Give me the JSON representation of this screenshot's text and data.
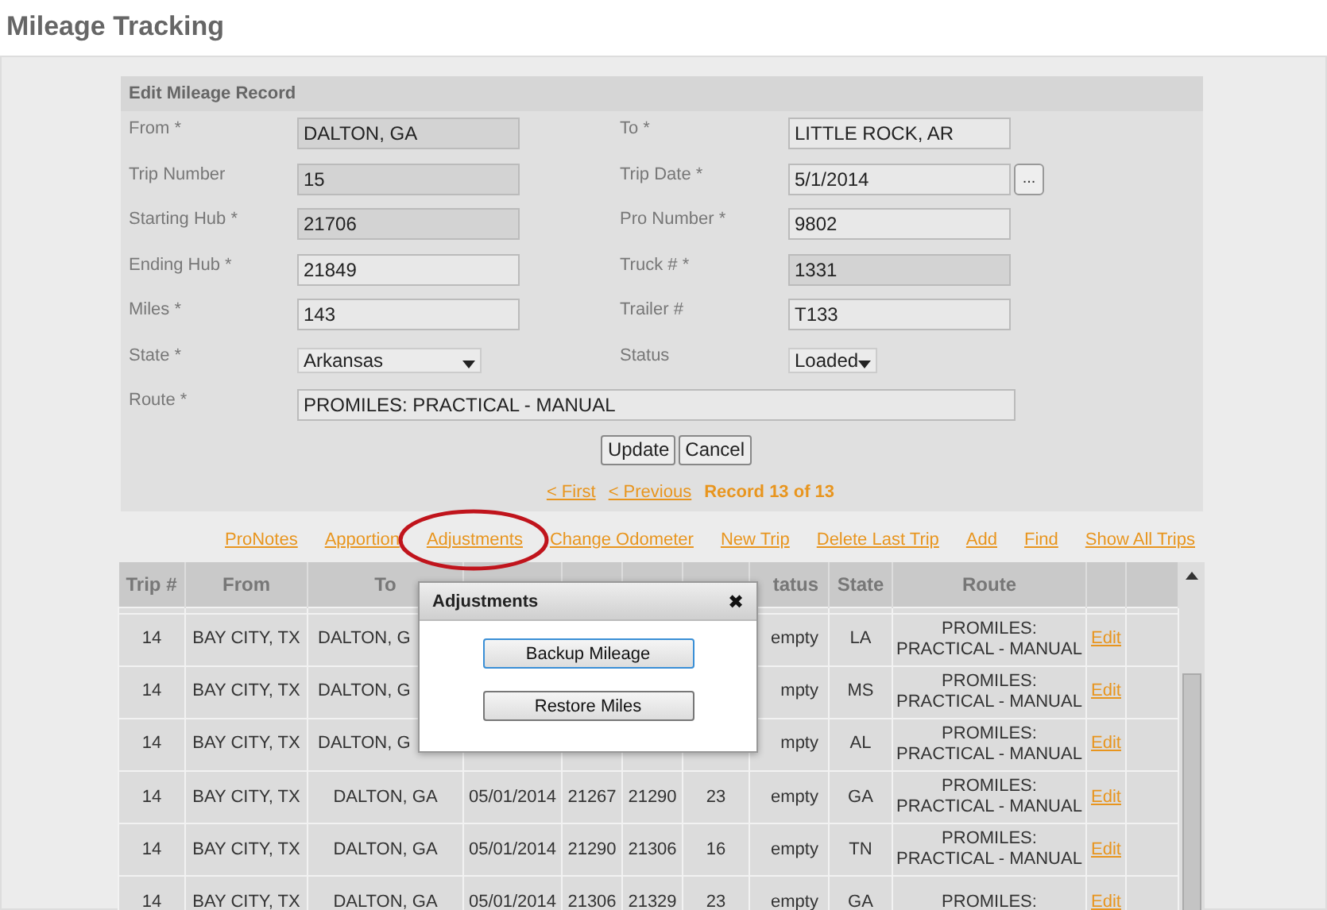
{
  "page_title": "Mileage Tracking",
  "form": {
    "title": "Edit Mileage Record",
    "fields": [
      {
        "label": "From *",
        "kind": "text",
        "value": "DALTON, GA",
        "readonly": true
      },
      {
        "label": "To *",
        "kind": "text",
        "value": "LITTLE ROCK, AR",
        "readonly": false
      },
      {
        "label": "Trip Number",
        "kind": "text",
        "value": "15",
        "readonly": true
      },
      {
        "label": "Trip Date *",
        "kind": "date",
        "value": "5/1/2014",
        "readonly": false,
        "button": "..."
      },
      {
        "label": "Starting Hub *",
        "kind": "text",
        "value": "21706",
        "readonly": true
      },
      {
        "label": "Pro Number *",
        "kind": "text",
        "value": "9802",
        "readonly": false
      },
      {
        "label": "Ending Hub *",
        "kind": "text",
        "value": "21849",
        "readonly": false
      },
      {
        "label": "Truck # *",
        "kind": "text",
        "value": "1331",
        "readonly": true
      },
      {
        "label": "Miles *",
        "kind": "text",
        "value": "143",
        "readonly": false
      },
      {
        "label": "Trailer #",
        "kind": "text",
        "value": "T133",
        "readonly": false
      },
      {
        "label": "State *",
        "kind": "select",
        "value": "Arkansas",
        "readonly": false
      },
      {
        "label": "Status",
        "kind": "select",
        "value": "Loaded",
        "readonly": false
      },
      {
        "label": "Route *",
        "kind": "wide",
        "value": "PROMILES: PRACTICAL - MANUAL",
        "readonly": false
      }
    ],
    "buttons": [
      "Update",
      "Cancel"
    ]
  },
  "pager": {
    "links": [
      "< First",
      "< Previous"
    ],
    "record": "Record 13 of 13"
  },
  "actions": [
    "ProNotes",
    "Apportion",
    "Adjustments",
    "Change Odometer",
    "New Trip",
    "Delete Last Trip",
    "Add",
    "Find",
    "Show All Trips"
  ],
  "table": {
    "columns": [
      "Trip #",
      "From",
      "To",
      "tatus",
      "State",
      "Route"
    ],
    "rows": [
      {
        "trip": "14",
        "from": "BAY CITY, TX",
        "to": "DALTON, G",
        "status": "empty",
        "state": "LA",
        "route": "PROMILES: PRACTICAL - MANUAL",
        "action": "Edit"
      },
      {
        "trip": "14",
        "from": "BAY CITY, TX",
        "to": "DALTON, G",
        "status": "mpty",
        "state": "MS",
        "route": "PROMILES: PRACTICAL - MANUAL",
        "action": "Edit"
      },
      {
        "trip": "14",
        "from": "BAY CITY, TX",
        "to": "DALTON, G",
        "status": "mpty",
        "state": "AL",
        "route": "PROMILES: PRACTICAL - MANUAL",
        "action": "Edit"
      },
      {
        "trip": "14",
        "from": "BAY CITY, TX",
        "to": "DALTON, GA",
        "date": "05/01/2014",
        "start": "21267",
        "end": "21290",
        "miles": "23",
        "status": "empty",
        "state": "GA",
        "route": "PROMILES: PRACTICAL - MANUAL",
        "action": "Edit"
      },
      {
        "trip": "14",
        "from": "BAY CITY, TX",
        "to": "DALTON, GA",
        "date": "05/01/2014",
        "start": "21290",
        "end": "21306",
        "miles": "16",
        "status": "empty",
        "state": "TN",
        "route": "PROMILES: PRACTICAL - MANUAL",
        "action": "Edit"
      },
      {
        "trip": "14",
        "from": "BAY CITY, TX",
        "to": "DALTON, GA",
        "date": "05/01/2014",
        "start": "21306",
        "end": "21329",
        "miles": "23",
        "status": "empty",
        "state": "GA",
        "route": "PROMILES:",
        "action": "Edit"
      }
    ]
  },
  "dialog": {
    "title": "Adjustments",
    "close": "✖",
    "buttons": [
      "Backup Mileage",
      "Restore Miles"
    ]
  }
}
